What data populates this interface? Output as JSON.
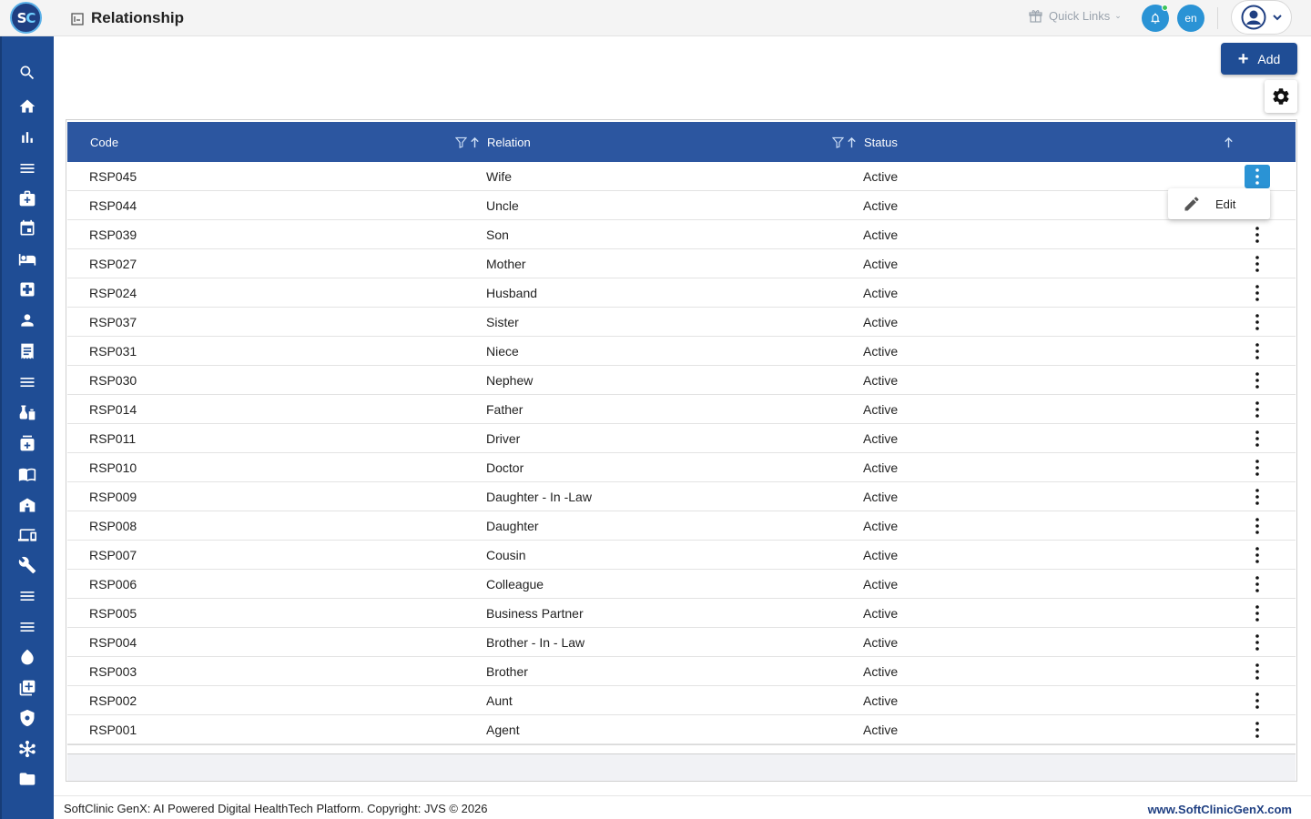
{
  "app": {
    "logo_text_s": "S",
    "logo_text_c": "C",
    "page_title": "Relationship"
  },
  "header": {
    "quick_links": "Quick Links",
    "language": "en"
  },
  "sidebar": {
    "icons": [
      "search-icon",
      "home-icon",
      "bar-chart-icon",
      "menu-icon",
      "medical-bag-icon",
      "calendar-icon",
      "bed-icon",
      "medical-plus-icon",
      "person-icon",
      "receipt-icon",
      "list-icon",
      "lab-icon",
      "pharmacy-icon",
      "book-icon",
      "store-icon",
      "devices-icon",
      "wrench-icon",
      "list2-icon",
      "list3-icon",
      "drop-icon",
      "library-add-icon",
      "shield-icon",
      "hub-icon",
      "folder-icon"
    ]
  },
  "toolbar": {
    "add_label": "Add"
  },
  "grid": {
    "columns": {
      "code": "Code",
      "relation": "Relation",
      "status": "Status"
    },
    "rows": [
      {
        "code": "RSP045",
        "relation": "Wife",
        "status": "Active"
      },
      {
        "code": "RSP044",
        "relation": "Uncle",
        "status": "Active"
      },
      {
        "code": "RSP039",
        "relation": "Son",
        "status": "Active"
      },
      {
        "code": "RSP027",
        "relation": "Mother",
        "status": "Active"
      },
      {
        "code": "RSP024",
        "relation": "Husband",
        "status": "Active"
      },
      {
        "code": "RSP037",
        "relation": "Sister",
        "status": "Active"
      },
      {
        "code": "RSP031",
        "relation": "Niece",
        "status": "Active"
      },
      {
        "code": "RSP030",
        "relation": "Nephew",
        "status": "Active"
      },
      {
        "code": "RSP014",
        "relation": "Father",
        "status": "Active"
      },
      {
        "code": "RSP011",
        "relation": "Driver",
        "status": "Active"
      },
      {
        "code": "RSP010",
        "relation": "Doctor",
        "status": "Active"
      },
      {
        "code": "RSP009",
        "relation": "Daughter - In -Law",
        "status": "Active"
      },
      {
        "code": "RSP008",
        "relation": "Daughter",
        "status": "Active"
      },
      {
        "code": "RSP007",
        "relation": "Cousin",
        "status": "Active"
      },
      {
        "code": "RSP006",
        "relation": "Colleague",
        "status": "Active"
      },
      {
        "code": "RSP005",
        "relation": "Business Partner",
        "status": "Active"
      },
      {
        "code": "RSP004",
        "relation": "Brother - In - Law",
        "status": "Active"
      },
      {
        "code": "RSP003",
        "relation": "Brother",
        "status": "Active"
      },
      {
        "code": "RSP002",
        "relation": "Aunt",
        "status": "Active"
      },
      {
        "code": "RSP001",
        "relation": "Agent",
        "status": "Active"
      }
    ]
  },
  "context_menu": {
    "edit_label": "Edit"
  },
  "footer": {
    "copyright": "SoftClinic GenX: AI Powered Digital HealthTech Platform. Copyright: JVS © 2026",
    "website": "www.SoftClinicGenX.com"
  },
  "colors": {
    "brand": "#1f4d95",
    "header_row": "#2c56a0",
    "accent": "#2a93d5"
  }
}
